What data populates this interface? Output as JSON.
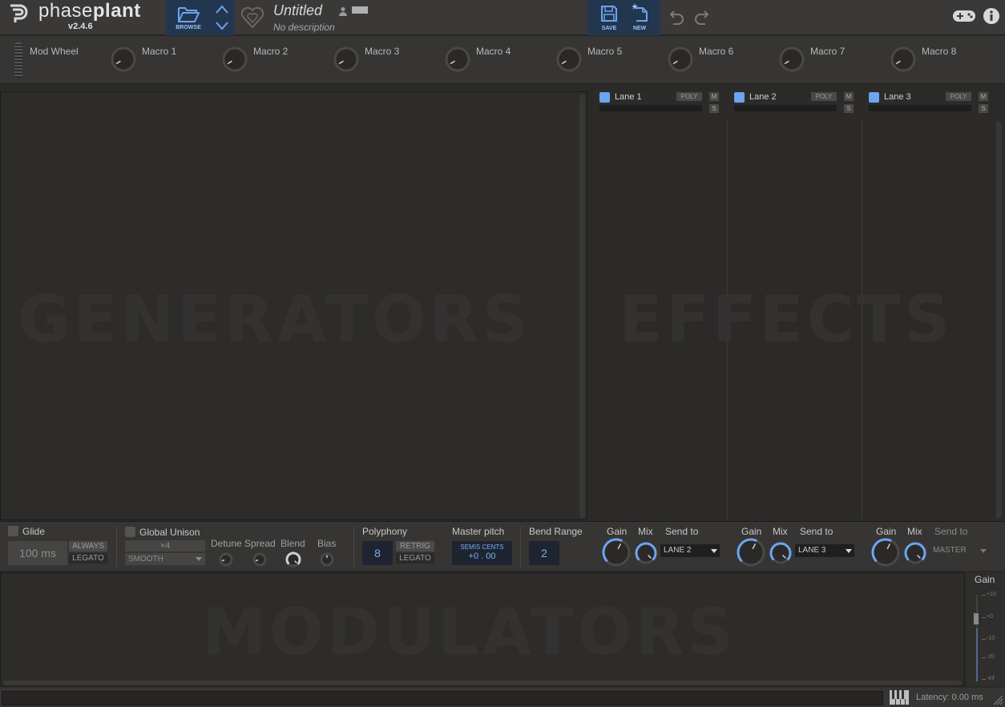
{
  "app": {
    "brand_light": "phase",
    "brand_bold": "plant",
    "version": "v2.4.6"
  },
  "toolbar": {
    "browse_label": "BROWSE",
    "preset_name": "Untitled",
    "preset_description": "No description",
    "save_label": "SAVE",
    "new_label": "NEW"
  },
  "macros": {
    "mod_wheel": "Mod Wheel",
    "items": [
      "Macro 1",
      "Macro 2",
      "Macro 3",
      "Macro 4",
      "Macro 5",
      "Macro 6",
      "Macro 7",
      "Macro 8"
    ]
  },
  "generators": {
    "watermark": "GENERATORS"
  },
  "effects": {
    "watermark": "EFFECTS",
    "lanes": [
      {
        "name": "Lane 1",
        "poly": "POLY",
        "mute": "M",
        "solo": "S",
        "gain": "Gain",
        "mix": "Mix",
        "send_to": "Send to",
        "send_value": "LANE 2"
      },
      {
        "name": "Lane 2",
        "poly": "POLY",
        "mute": "M",
        "solo": "S",
        "gain": "Gain",
        "mix": "Mix",
        "send_to": "Send to",
        "send_value": "LANE 3"
      },
      {
        "name": "Lane 3",
        "poly": "POLY",
        "mute": "M",
        "solo": "S",
        "gain": "Gain",
        "mix": "Mix",
        "send_to": "Send to",
        "send_value": "MASTER"
      }
    ]
  },
  "controls": {
    "glide": {
      "label": "Glide",
      "value": "100 ms",
      "always": "ALWAYS",
      "legato": "LEGATO"
    },
    "unison": {
      "label": "Global Unison",
      "voices": "×4",
      "mode": "SMOOTH",
      "detune": "Detune",
      "spread": "Spread",
      "blend": "Blend",
      "bias": "Bias"
    },
    "polyphony": {
      "label": "Polyphony",
      "value": "8",
      "retrig": "RETRIG",
      "legato": "LEGATO"
    },
    "master_pitch": {
      "label": "Master pitch",
      "semis": "SEMIS",
      "cents": "CENTS",
      "value": "+0 . 00"
    },
    "bend_range": {
      "label": "Bend Range",
      "value": "2"
    }
  },
  "modulators": {
    "watermark": "MODULATORS"
  },
  "master_gain": {
    "label": "Gain",
    "ticks": [
      "+10",
      "+0",
      "-10",
      "-20",
      "-inf"
    ]
  },
  "status": {
    "latency": "Latency: 0.00 ms"
  },
  "colors": {
    "accent": "#6ca4f0",
    "toolbar_blue": "#23364f"
  }
}
